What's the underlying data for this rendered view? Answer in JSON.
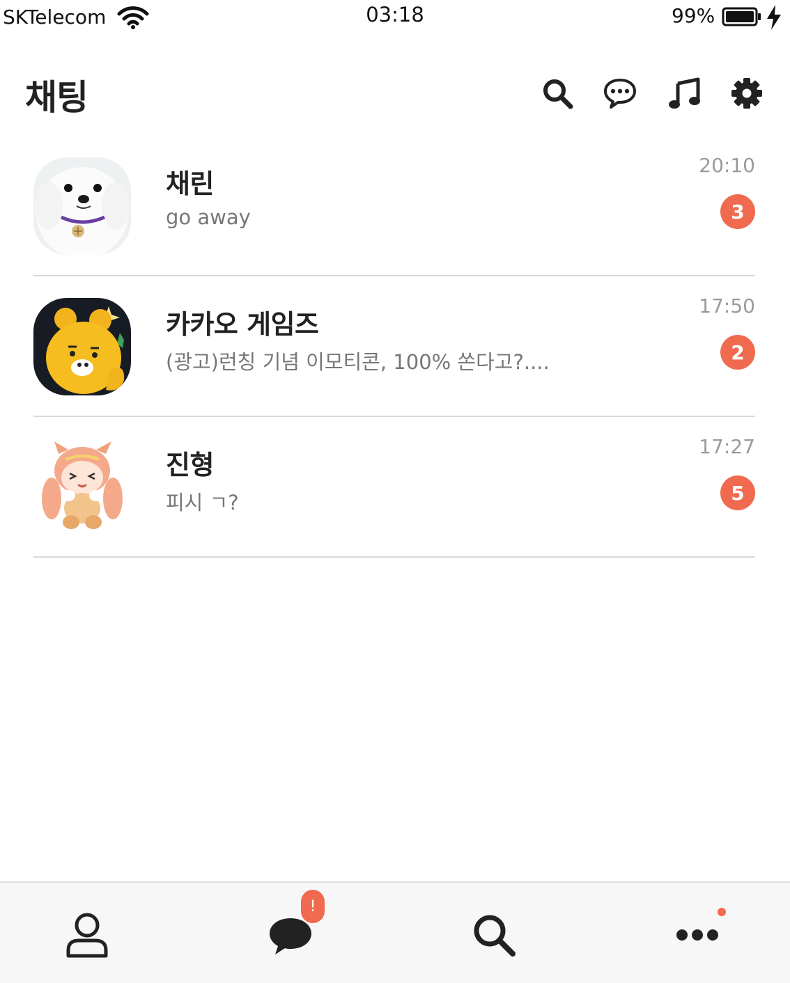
{
  "status_bar": {
    "carrier": "SKTelecom",
    "time": "03:18",
    "battery": "99%"
  },
  "header": {
    "title": "채팅",
    "icons": [
      "search-icon",
      "new-chat-icon",
      "music-icon",
      "settings-icon"
    ]
  },
  "chats": [
    {
      "name": "채린",
      "preview": "go away",
      "time": "20:10",
      "unread": "3",
      "avatar": "white-dog-photo"
    },
    {
      "name": "카카오 게임즈",
      "preview": "(광고)런칭 기념 이모티콘, 100% 쏜다고?....",
      "time": "17:50",
      "unread": "2",
      "avatar": "ryan-character"
    },
    {
      "name": "진형",
      "preview": "피시 ㄱ?",
      "time": "17:27",
      "unread": "5",
      "avatar": "cat-girl-character"
    }
  ],
  "tab_bar": {
    "tabs": [
      "friends-tab",
      "chats-tab",
      "search-tab",
      "more-tab"
    ],
    "chats_badge": "!"
  },
  "colors": {
    "accent": "#ef6a4f",
    "text_primary": "#222222",
    "text_secondary": "#777777",
    "divider": "#d9d9d9"
  }
}
